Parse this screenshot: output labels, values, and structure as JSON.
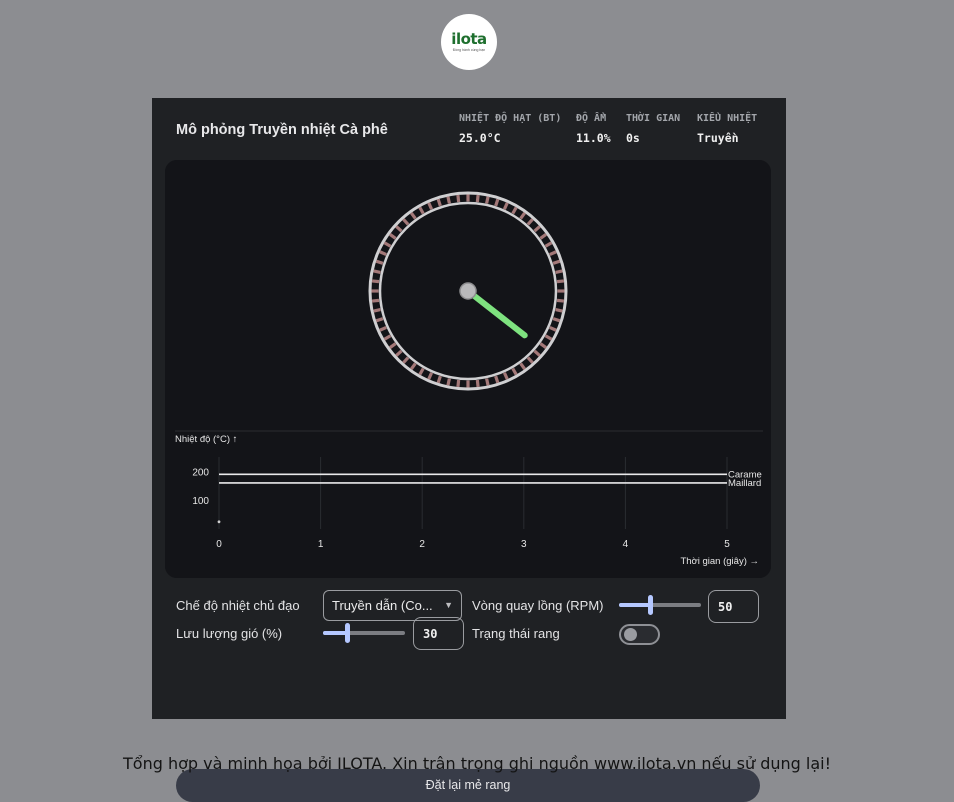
{
  "logo": {
    "text": "ilota",
    "tagline": "Đồng hành cùng bạn"
  },
  "app": {
    "title": "Mô phỏng Truyền nhiệt Cà phê"
  },
  "stats": [
    {
      "label": "NHIỆT ĐỘ HẠT (BT)",
      "value": "25.0°C"
    },
    {
      "label": "ĐỘ ẨM",
      "value": "11.0%"
    },
    {
      "label": "THỜI GIAN",
      "value": "0s"
    },
    {
      "label": "KIỂU NHIỆT",
      "value": "Truyền"
    }
  ],
  "drum": {
    "paddle_angle_deg": 38,
    "colors": {
      "rim": "#cfcfd1",
      "tick": "#a37878",
      "paddle": "#7ee27f",
      "hub": "#b9b9bb",
      "bg": "#131418"
    }
  },
  "chart_data": {
    "type": "line",
    "ylabel": "Nhiệt độ (°C) ↑",
    "xlabel": "Thời gian (giây) →",
    "xlim": [
      0,
      5
    ],
    "ylim": [
      0,
      250
    ],
    "x_ticks": [
      "0",
      "1",
      "2",
      "3",
      "4",
      "5"
    ],
    "y_ticks": [
      {
        "value": 200,
        "label": "200"
      },
      {
        "value": 100,
        "label": "100"
      }
    ],
    "reference_lines": [
      {
        "name": "Carame",
        "y": 190
      },
      {
        "name": "Maillard",
        "y": 160
      }
    ],
    "series": [
      {
        "x": [
          0
        ],
        "y": [
          25
        ]
      }
    ],
    "grid": true
  },
  "controls": {
    "heat_mode_label": "Chế độ nhiệt chủ đạo",
    "heat_mode_value": "Truyền dẫn (Co...",
    "drum_speed_label": "Vòng quay lồng (RPM)",
    "drum_speed_value": "50",
    "drum_speed_fraction": 0.38,
    "airflow_label": "Lưu lượng gió (%)",
    "airflow_value": "30",
    "airflow_fraction": 0.3,
    "roast_state_label": "Trạng thái rang",
    "roast_state_on": false,
    "reset_label": "Đặt lại mẻ rang"
  },
  "footer": {
    "text": "Tổng hợp và minh họa bởi ILOTA. Xin trân trọng ghi nguồn www.ilota.vn nếu sử dụng lại!"
  }
}
